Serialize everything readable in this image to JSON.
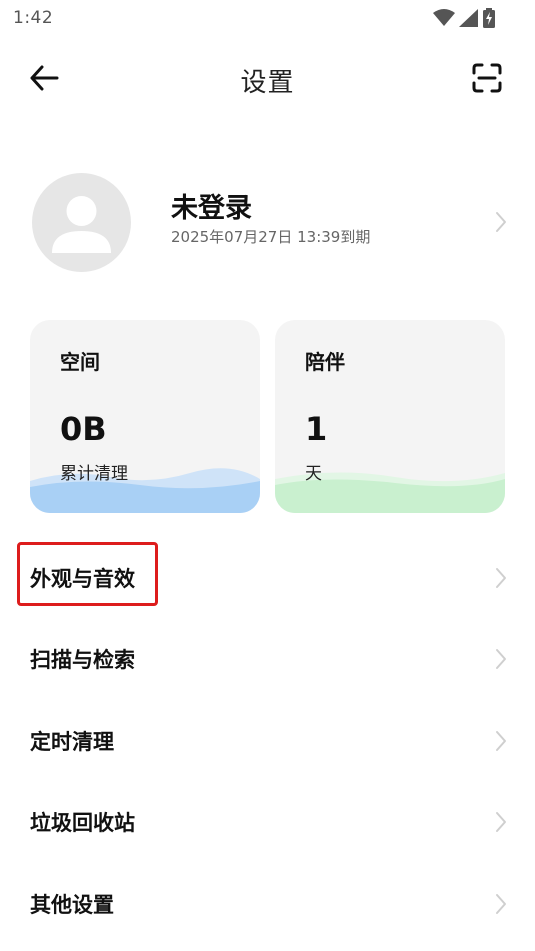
{
  "status_bar": {
    "time": "1:42",
    "icons": [
      "wifi-icon",
      "signal-icon",
      "battery-charging-icon"
    ]
  },
  "header": {
    "title": "设置",
    "back_icon": "arrow-left-icon",
    "scan_icon": "scan-icon"
  },
  "profile": {
    "name": "未登录",
    "expiry": "2025年07月27日 13:39到期",
    "avatar_icon": "user-avatar-icon"
  },
  "cards": [
    {
      "title": "空间",
      "value": "0B",
      "subtitle": "累计清理",
      "wave_color": "#a9d0f5"
    },
    {
      "title": "陪伴",
      "value": "1",
      "subtitle": "天",
      "wave_color": "#c9f0cf"
    }
  ],
  "menu": [
    {
      "label": "外观与音效",
      "highlighted": true
    },
    {
      "label": "扫描与检索",
      "highlighted": false
    },
    {
      "label": "定时清理",
      "highlighted": false
    },
    {
      "label": "垃圾回收站",
      "highlighted": false
    },
    {
      "label": "其他设置",
      "highlighted": false
    }
  ],
  "colors": {
    "highlight": "#dd1c1c",
    "card_bg": "#f4f4f4",
    "chevron": "#cfcfcf"
  }
}
